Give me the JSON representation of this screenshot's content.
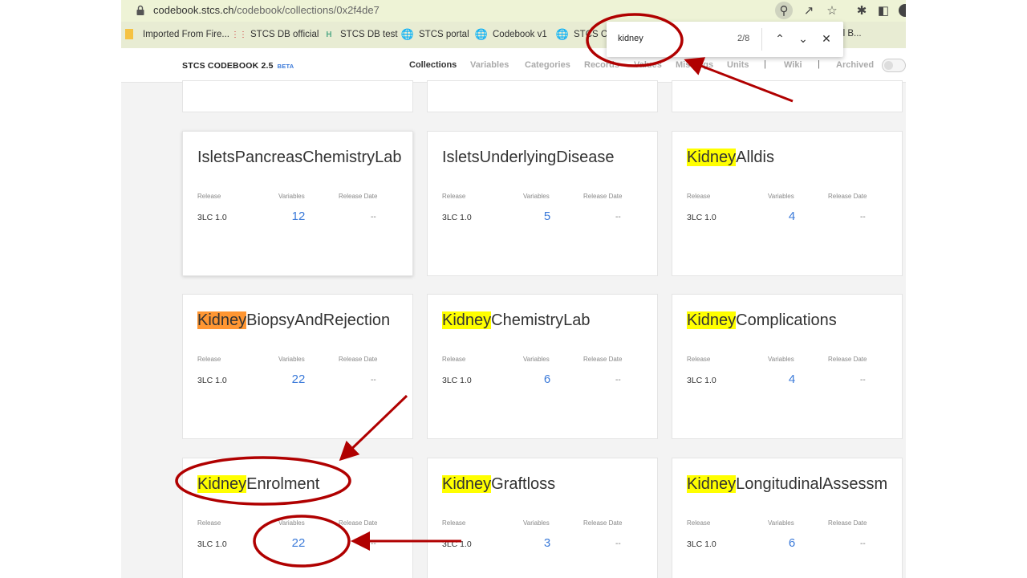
{
  "browser": {
    "url_host": "codebook.stcs.ch",
    "url_path": "/codebook/collections/0x2f4de7",
    "bookmarks": [
      {
        "label": "Imported From Fire...",
        "icon": "folder-icon"
      },
      {
        "label": "STCS DB official",
        "icon": "dots-icon"
      },
      {
        "label": "STCS DB test",
        "icon": "h-icon"
      },
      {
        "label": "STCS portal",
        "icon": "globe-icon"
      },
      {
        "label": "Codebook v1",
        "icon": "globe-icon"
      },
      {
        "label": "STCS Co",
        "icon": "globe-icon"
      },
      {
        "label": "tal B...",
        "icon": "globe-icon"
      }
    ]
  },
  "findbar": {
    "query": "kidney",
    "count": "2/8"
  },
  "app": {
    "brand": "STCS CODEBOOK 2.5",
    "beta": "BETA",
    "nav": [
      "Collections",
      "Variables",
      "Categories",
      "Records",
      "Values",
      "Missings",
      "Units",
      "|",
      "Wiki",
      "|",
      "Archived"
    ]
  },
  "labels": {
    "release": "Release",
    "variables": "Variables",
    "release_date": "Release Date"
  },
  "cards": [
    {
      "prefix": "",
      "title": "IsletsPancreasChemistryLab",
      "release": "3LC 1.0",
      "variables": "12",
      "date": "--"
    },
    {
      "prefix": "",
      "title": "IsletsUnderlyingDisease",
      "release": "3LC 1.0",
      "variables": "5",
      "date": "--"
    },
    {
      "prefix": "Kidney",
      "title": "Alldis",
      "release": "3LC 1.0",
      "variables": "4",
      "date": "--"
    },
    {
      "prefix": "Kidney",
      "title": "BiopsyAndRejection",
      "release": "3LC 1.0",
      "variables": "22",
      "date": "--"
    },
    {
      "prefix": "Kidney",
      "title": "ChemistryLab",
      "release": "3LC 1.0",
      "variables": "6",
      "date": "--"
    },
    {
      "prefix": "Kidney",
      "title": "Complications",
      "release": "3LC 1.0",
      "variables": "4",
      "date": "--"
    },
    {
      "prefix": "Kidney",
      "title": "Enrolment",
      "release": "3LC 1.0",
      "variables": "22",
      "date": "--"
    },
    {
      "prefix": "Kidney",
      "title": "Graftloss",
      "release": "3LC 1.0",
      "variables": "3",
      "date": "--"
    },
    {
      "prefix": "Kidney",
      "title": "LongitudinalAssessm",
      "release": "3LC 1.0",
      "variables": "6",
      "date": "--"
    }
  ],
  "colors": {
    "highlight": "#ffff00",
    "current_match": "#ff9632",
    "accent": "#3b7ad9",
    "annotation": "#b00000"
  }
}
